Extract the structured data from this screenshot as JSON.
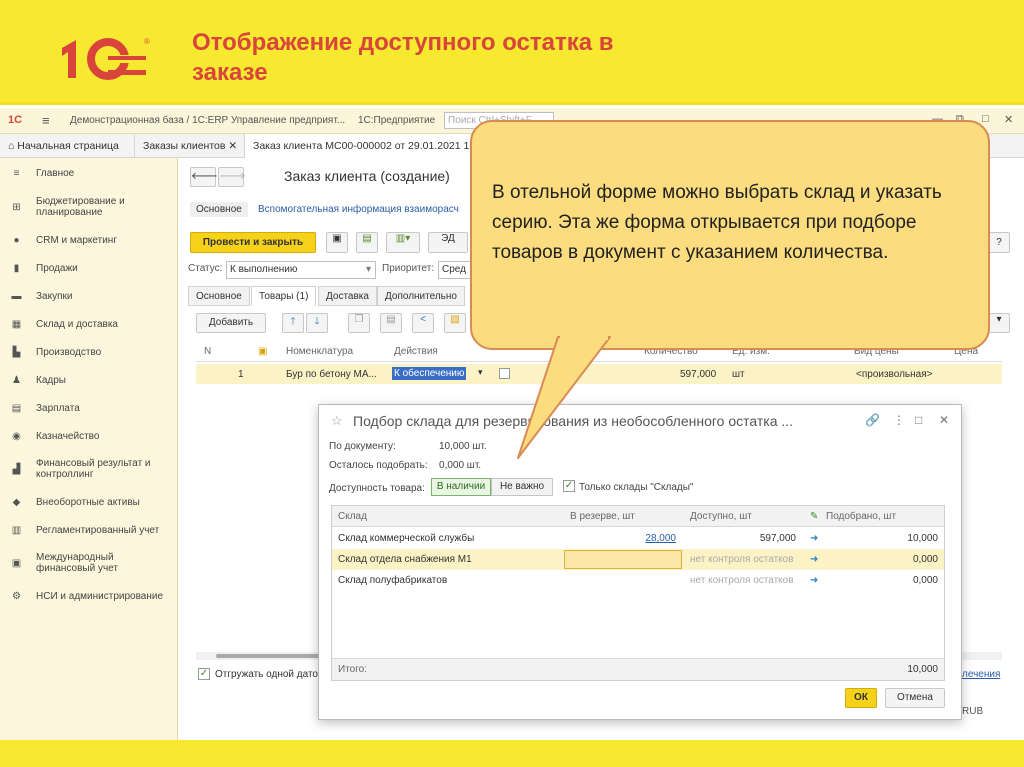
{
  "slide": {
    "title_line1": "Отображение доступного остатка в",
    "title_line2": "заказе"
  },
  "topbar": {
    "title": "Демонстрационная база / 1С:ERP Управление предприят...",
    "app": "1С:Предприятие",
    "search_placeholder": "Поиск Ctrl+Shift+F"
  },
  "tabs": [
    "Начальная страница",
    "Заказы клиентов",
    "Заказ клиента МС00-000002 от 29.01.2021 18"
  ],
  "sidebar": [
    "Главное",
    "Бюджетирование и планирование",
    "CRM и маркетинг",
    "Продажи",
    "Закупки",
    "Склад и доставка",
    "Производство",
    "Кадры",
    "Зарплата",
    "Казначейство",
    "Финансовый результат и контроллинг",
    "Внеоборотные активы",
    "Регламентированный учет",
    "Международный финансовый учет",
    "НСИ и администрирование"
  ],
  "form": {
    "title": "Заказ клиента (создание)",
    "subtab_main": "Основное",
    "subtab_aux": "Вспомогательная информация взаиморасч",
    "post_close": "Провести и закрыть",
    "status_label": "Статус:",
    "status_value": "К выполнению",
    "priority_label": "Приоритет:",
    "priority_value": "Сред",
    "tabs": [
      "Основное",
      "Товары (1)",
      "Доставка",
      "Дополнительно"
    ],
    "add": "Добавить",
    "columns": [
      "N",
      "Номенклатура",
      "Действия",
      "Количество",
      "Ед. изм.",
      "Вид цены",
      "Цена"
    ],
    "row": {
      "n": "1",
      "item": "Бур по бетону МА...",
      "action": "К обеспечению",
      "qty": "597,000",
      "unit": "шт",
      "price_type": "<произвольная>"
    },
    "ship_one_date": "Отгружать одной дато",
    "link_right": "лечения",
    "currency": "RUB",
    "help": "?"
  },
  "dialog": {
    "title": "Подбор склада для резервирования из необособленного остатка ...",
    "by_doc_label": "По документу:",
    "by_doc_value": "10,000 шт.",
    "left_label": "Осталось подобрать:",
    "left_value": "0,000 шт.",
    "avail_label": "Доступность товара:",
    "in_stock": "В наличии",
    "not_important": "Не важно",
    "only_warehouses": "Только склады \"Склады\"",
    "columns": [
      "Склад",
      "В резерве, шт",
      "Доступно, шт",
      "Подобрано, шт"
    ],
    "rows": [
      {
        "name": "Склад коммерческой службы",
        "reserve": "28,000",
        "available": "597,000",
        "picked": "10,000"
      },
      {
        "name": "Склад отдела снабжения М1",
        "reserve": "",
        "available": "нет контроля остатков",
        "picked": "0,000"
      },
      {
        "name": "Склад полуфабрикатов",
        "reserve": "",
        "available": "нет контроля остатков",
        "picked": "0,000"
      }
    ],
    "total_label": "Итого:",
    "total_value": "10,000",
    "ok": "ОК",
    "cancel": "Отмена"
  },
  "callout": {
    "text": "В отельной форме можно выбрать склад и указать серию. Эта же форма открывается при подборе товаров в документ с указанием количества."
  },
  "colors": {
    "brand_red": "#d9453b",
    "banner_yellow": "#f7e830",
    "callout_bg": "#fbdc7e",
    "callout_border": "#d98b54"
  }
}
